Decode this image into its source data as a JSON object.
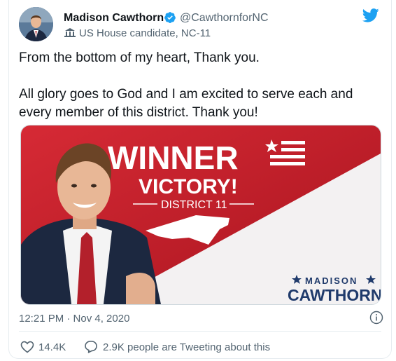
{
  "author": {
    "display_name": "Madison Cawthorn",
    "handle": "@CawthornforNC",
    "bio": "US House candidate, NC-11"
  },
  "tweet": {
    "lines": [
      "From the bottom of my heart, Thank you.",
      "All glory goes to God and I am excited to serve each and every member of this district. Thank you!"
    ],
    "timestamp": "12:21 PM · Nov 4, 2020"
  },
  "media": {
    "headline": "WINNER",
    "subhead": "VICTORY!",
    "district": "DISTRICT 11",
    "brand_top": "MADISON",
    "brand_bottom": "CAWTHORN"
  },
  "engagement": {
    "likes": "14.4K",
    "replies_text": "2.9K people are Tweeting about this"
  },
  "colors": {
    "twitter_blue": "#1da1f2",
    "banner_red": "#c8202d",
    "navy": "#1f3a6b"
  },
  "icons": {
    "verified": "verified-badge-icon",
    "bio": "building-icon",
    "brand": "twitter-bird-icon",
    "info": "info-icon",
    "like": "heart-icon",
    "reply": "speech-bubble-icon"
  }
}
